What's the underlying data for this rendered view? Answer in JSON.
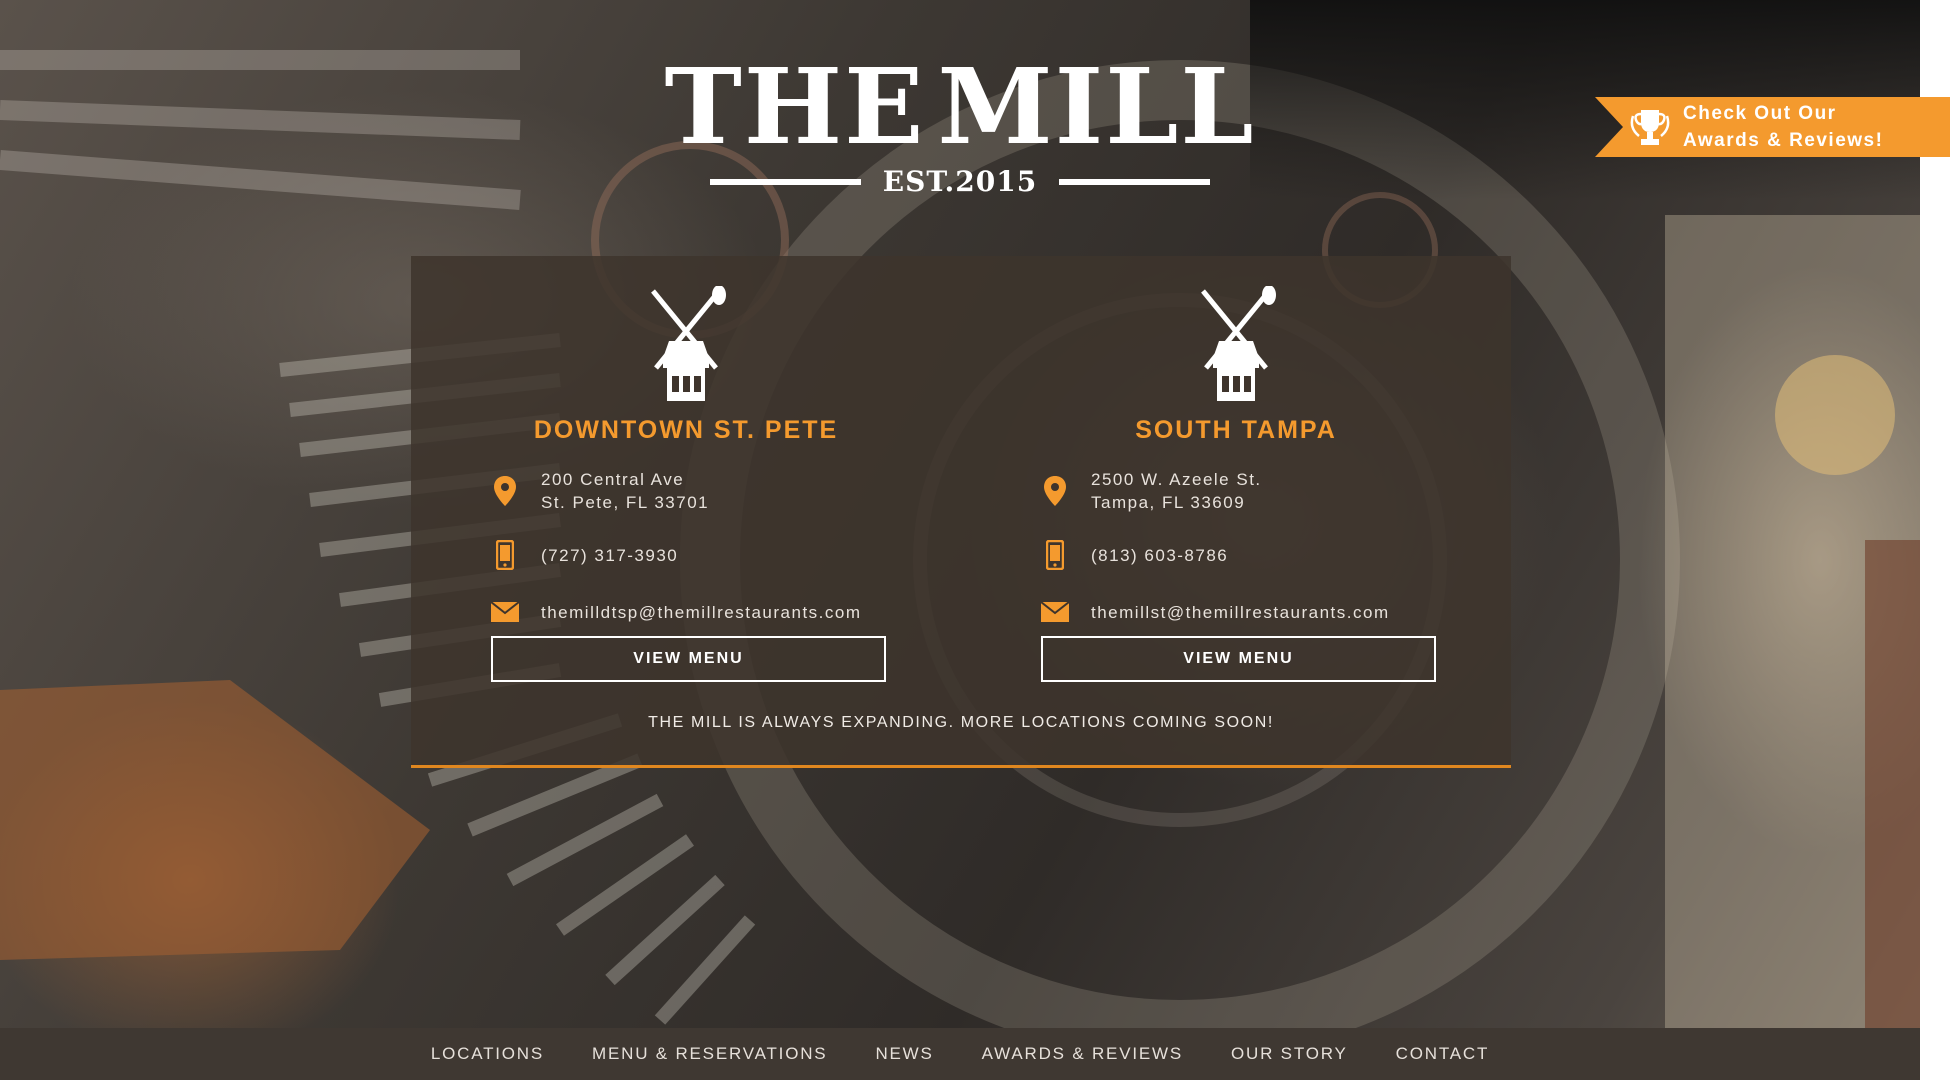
{
  "brand": {
    "left_word": "THE",
    "right_word": "MILL",
    "established": "EST.2015"
  },
  "awards_ribbon": {
    "line1": "Check Out Our",
    "line2": "Awards & Reviews!",
    "icon": "trophy-icon",
    "color": "#f49a2e"
  },
  "locations": [
    {
      "name": "DOWNTOWN ST. PETE",
      "address_line1": "200 Central Ave",
      "address_line2": "St. Pete, FL 33701",
      "phone": "(727) 317-3930",
      "email": "themilldtsp@themillrestaurants.com",
      "button": "VIEW MENU"
    },
    {
      "name": "SOUTH TAMPA",
      "address_line1": "2500 W. Azeele St.",
      "address_line2": "Tampa, FL 33609",
      "phone": "(813) 603-8786",
      "email": "themillst@themillrestaurants.com",
      "button": "VIEW MENU"
    }
  ],
  "expanding_note": "THE MILL IS ALWAYS EXPANDING. MORE LOCATIONS COMING SOON!",
  "nav": [
    "LOCATIONS",
    "MENU & RESERVATIONS",
    "NEWS",
    "AWARDS & REVIEWS",
    "OUR STORY",
    "CONTACT"
  ],
  "icons": {
    "address": "map-pin-icon",
    "phone": "mobile-phone-icon",
    "email": "envelope-icon",
    "location_logo": "windmill-logo-icon"
  },
  "colors": {
    "accent": "#f49a2e",
    "panel": "#3e342c",
    "nav_bg": "#3f3832"
  }
}
